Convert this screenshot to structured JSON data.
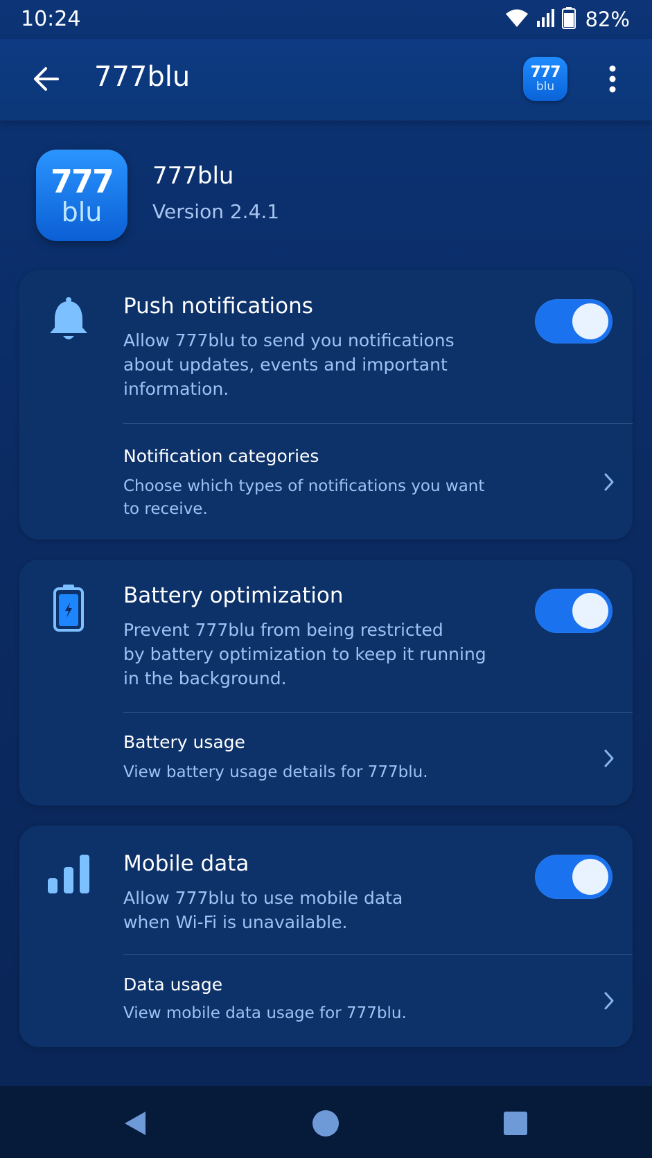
{
  "status_bar": {
    "time": "10:24",
    "battery_percent": "82%",
    "icons": [
      "wifi-icon",
      "cellular-signal-icon",
      "battery-icon"
    ]
  },
  "app_bar": {
    "title": "777blu",
    "logo": {
      "top": "777",
      "bottom": "blu"
    },
    "back_icon": "arrow-left-icon",
    "menu_icon": "more-vertical-icon"
  },
  "app_header": {
    "logo": {
      "top": "777",
      "bottom": "blu"
    },
    "name": "777blu",
    "version": "Version 2.4.1"
  },
  "sections": [
    {
      "icon": "bell-icon",
      "title": "Push notifications",
      "description_lines": [
        "Allow 777blu to send you notifications",
        "about updates, events and important",
        "information."
      ],
      "toggle_on": true,
      "sub_item": {
        "title": "Notification categories",
        "description_lines": [
          "Choose which types of notifications you want",
          "to receive."
        ]
      }
    },
    {
      "icon": "battery-icon",
      "title": "Battery optimization",
      "description_lines": [
        "Prevent 777blu from being restricted",
        "by battery optimization to keep it running",
        "in the background."
      ],
      "toggle_on": true,
      "sub_item": {
        "title": "Battery usage",
        "description_lines": [
          "View battery usage details for 777blu."
        ]
      }
    },
    {
      "icon": "signal-bars-icon",
      "title": "Mobile data",
      "description_lines": [
        "Allow 777blu to use mobile data",
        "when Wi-Fi is unavailable."
      ],
      "toggle_on": true,
      "sub_item": {
        "title": "Data usage",
        "description_lines": [
          "View mobile data usage for 777blu."
        ]
      }
    }
  ],
  "nav_bar": {
    "buttons": [
      "back-triangle-icon",
      "home-circle-icon",
      "recents-square-icon"
    ]
  },
  "colors": {
    "accent": "#1a72ee",
    "background": "#0b2a5c",
    "card": "#0d3169",
    "secondary_text": "#9ec2f3"
  }
}
